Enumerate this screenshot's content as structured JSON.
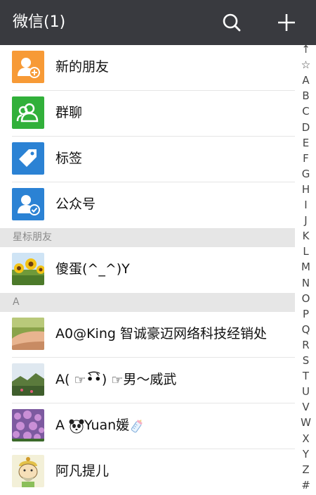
{
  "header": {
    "title": "微信(1)"
  },
  "functions": [
    {
      "label": "新的朋友",
      "icon": "add-friend-icon",
      "color": "#f79a36"
    },
    {
      "label": "群聊",
      "icon": "group-chat-icon",
      "color": "#31b03a"
    },
    {
      "label": "标签",
      "icon": "tag-icon",
      "color": "#2b82d4"
    },
    {
      "label": "公众号",
      "icon": "official-account-icon",
      "color": "#2b82d4"
    }
  ],
  "sections": {
    "starred": "星标朋友",
    "a": "A"
  },
  "starred_contacts": [
    {
      "name": "傻蛋(^_^)Y",
      "avatar": "sunflower-avatar"
    }
  ],
  "a_contacts": [
    {
      "name": "A0@King 智诚豪迈网络科技经销处",
      "avatar": "arm-photo-avatar"
    },
    {
      "name_prefix": "A( ",
      "name_mid": "•̀͡•̀)  ",
      "name_suffix": "男～威武",
      "avatar": "landscape-avatar"
    },
    {
      "name_prefix": "A ",
      "name_mid": "Yuan媛",
      "avatar": "flower-field-avatar"
    },
    {
      "name": "阿凡提儿",
      "avatar": "cartoon-avatar"
    }
  ],
  "index_bar": [
    "↑",
    "☆",
    "A",
    "B",
    "C",
    "D",
    "E",
    "F",
    "G",
    "H",
    "I",
    "J",
    "K",
    "L",
    "M",
    "N",
    "O",
    "P",
    "Q",
    "R",
    "S",
    "T",
    "U",
    "V",
    "W",
    "X",
    "Y",
    "Z",
    "#"
  ]
}
